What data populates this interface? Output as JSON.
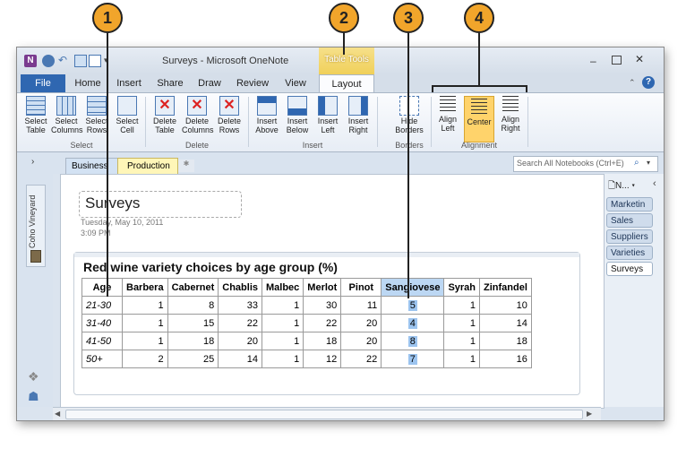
{
  "callouts": [
    "1",
    "2",
    "3",
    "4"
  ],
  "window": {
    "title": "Surveys - Microsoft OneNote",
    "context_tab": "Table Tools",
    "tabs": [
      "File",
      "Home",
      "Insert",
      "Share",
      "Draw",
      "Review",
      "View",
      "Layout"
    ],
    "active_tab": "Layout"
  },
  "ribbon": {
    "groups": [
      {
        "label": "Select",
        "buttons": [
          {
            "line1": "Select",
            "line2": "Table",
            "icon": "select-table-icon"
          },
          {
            "line1": "Select",
            "line2": "Columns",
            "icon": "select-columns-icon"
          },
          {
            "line1": "Select",
            "line2": "Rows",
            "icon": "select-rows-icon"
          },
          {
            "line1": "Select",
            "line2": "Cell",
            "icon": "select-cell-icon"
          }
        ]
      },
      {
        "label": "Delete",
        "buttons": [
          {
            "line1": "Delete",
            "line2": "Table",
            "icon": "delete-table-icon"
          },
          {
            "line1": "Delete",
            "line2": "Columns",
            "icon": "delete-columns-icon"
          },
          {
            "line1": "Delete",
            "line2": "Rows",
            "icon": "delete-rows-icon"
          }
        ]
      },
      {
        "label": "Insert",
        "buttons": [
          {
            "line1": "Insert",
            "line2": "Above",
            "icon": "insert-above-icon"
          },
          {
            "line1": "Insert",
            "line2": "Below",
            "icon": "insert-below-icon"
          },
          {
            "line1": "Insert",
            "line2": "Left",
            "icon": "insert-left-icon"
          },
          {
            "line1": "Insert",
            "line2": "Right",
            "icon": "insert-right-icon"
          }
        ]
      },
      {
        "label": "Borders",
        "buttons": [
          {
            "line1": "Hide",
            "line2": "Borders",
            "icon": "hide-borders-icon"
          }
        ]
      },
      {
        "label": "Alignment",
        "buttons": [
          {
            "line1": "Align",
            "line2": "Left",
            "icon": "align-left-icon"
          },
          {
            "line1": "Center",
            "line2": "",
            "icon": "align-center-icon"
          },
          {
            "line1": "Align",
            "line2": "Right",
            "icon": "align-right-icon"
          }
        ]
      }
    ]
  },
  "nav": {
    "sections": [
      "Business",
      "Production"
    ],
    "search_placeholder": "Search All Notebooks (Ctrl+E)"
  },
  "notebook": {
    "name": "Coho Vineyard"
  },
  "page": {
    "title": "Surveys",
    "date": "Tuesday, May 10, 2011",
    "time": "3:09 PM",
    "table_title": "Red wine variety choices by age group (%)",
    "columns": [
      "Age",
      "Barbera",
      "Cabernet",
      "Chablis",
      "Malbec",
      "Merlot",
      "Pinot",
      "Sangiovese",
      "Syrah",
      "Zinfandel"
    ],
    "rows": [
      [
        "21-30",
        "1",
        "8",
        "33",
        "1",
        "30",
        "11",
        "5",
        "1",
        "10"
      ],
      [
        "31-40",
        "1",
        "15",
        "22",
        "1",
        "22",
        "20",
        "4",
        "1",
        "14"
      ],
      [
        "41-50",
        "1",
        "18",
        "20",
        "1",
        "18",
        "20",
        "8",
        "1",
        "18"
      ],
      [
        "50+",
        "2",
        "25",
        "14",
        "1",
        "12",
        "22",
        "7",
        "1",
        "16"
      ]
    ],
    "highlight_col": 7
  },
  "right_pane": {
    "new_page": "N...",
    "pages": [
      "Marketin",
      "Sales",
      "Suppliers",
      "Varieties",
      "Surveys"
    ],
    "active_page": "Surveys"
  },
  "colors": {
    "accent": "#f1a52b",
    "context_tab": "#f3d86a",
    "active_button": "#ffd36b",
    "selection": "#bcd7f3"
  }
}
